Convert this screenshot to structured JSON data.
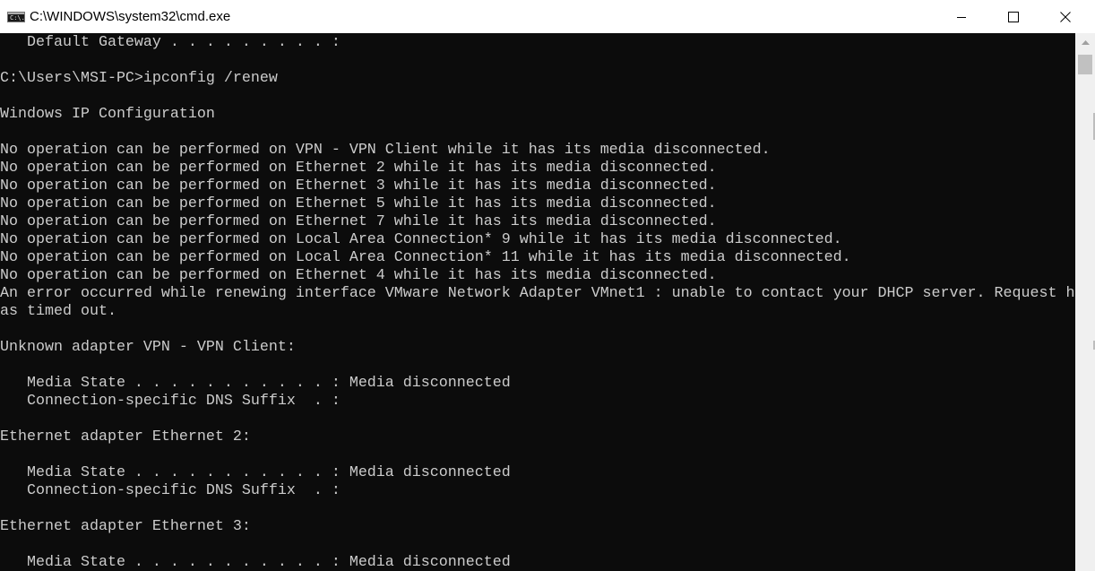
{
  "window": {
    "title": "C:\\WINDOWS\\system32\\cmd.exe",
    "icon_text": "C:\\."
  },
  "console": {
    "lines": [
      "   Default Gateway . . . . . . . . . :",
      "",
      "C:\\Users\\MSI-PC>ipconfig /renew",
      "",
      "Windows IP Configuration",
      "",
      "No operation can be performed on VPN - VPN Client while it has its media disconnected.",
      "No operation can be performed on Ethernet 2 while it has its media disconnected.",
      "No operation can be performed on Ethernet 3 while it has its media disconnected.",
      "No operation can be performed on Ethernet 5 while it has its media disconnected.",
      "No operation can be performed on Ethernet 7 while it has its media disconnected.",
      "No operation can be performed on Local Area Connection* 9 while it has its media disconnected.",
      "No operation can be performed on Local Area Connection* 11 while it has its media disconnected.",
      "No operation can be performed on Ethernet 4 while it has its media disconnected.",
      "An error occurred while renewing interface VMware Network Adapter VMnet1 : unable to contact your DHCP server. Request h",
      "as timed out.",
      "",
      "Unknown adapter VPN - VPN Client:",
      "",
      "   Media State . . . . . . . . . . . : Media disconnected",
      "   Connection-specific DNS Suffix  . :",
      "",
      "Ethernet adapter Ethernet 2:",
      "",
      "   Media State . . . . . . . . . . . : Media disconnected",
      "   Connection-specific DNS Suffix  . :",
      "",
      "Ethernet adapter Ethernet 3:",
      "",
      "   Media State . . . . . . . . . . . : Media disconnected"
    ]
  },
  "colors": {
    "console_background": "#0c0c0c",
    "console_text": "#cccccc",
    "titlebar_background": "#ffffff",
    "scrollbar_track": "#f0f0f0",
    "scrollbar_thumb": "#c1c1c1"
  },
  "icons": {
    "app": "cmd-console-icon",
    "minimize": "minimize-icon",
    "maximize": "maximize-icon",
    "close": "close-icon",
    "scroll_up": "scroll-up-arrow-icon"
  }
}
